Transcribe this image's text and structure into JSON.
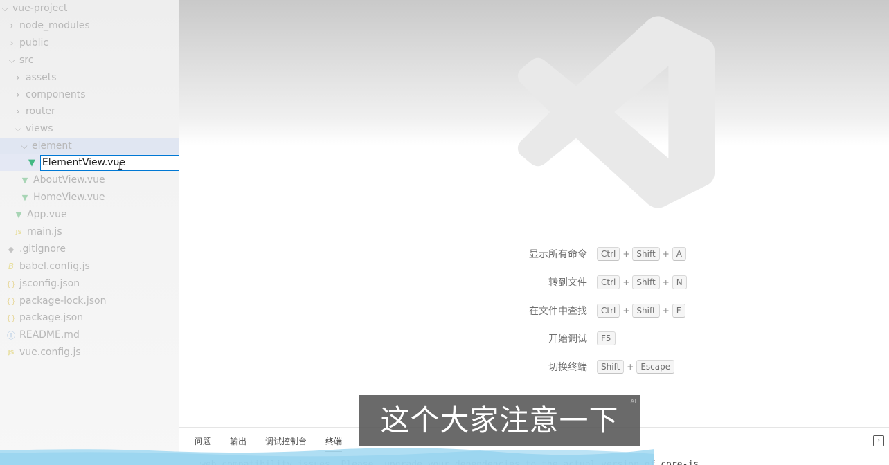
{
  "explorer": {
    "items": [
      {
        "label": "vue-project",
        "kind": "folder-open"
      },
      {
        "label": "node_modules",
        "kind": "folder"
      },
      {
        "label": "public",
        "kind": "folder"
      },
      {
        "label": "src",
        "kind": "folder-open"
      },
      {
        "label": "assets",
        "kind": "folder"
      },
      {
        "label": "components",
        "kind": "folder"
      },
      {
        "label": "router",
        "kind": "folder"
      },
      {
        "label": "views",
        "kind": "folder-open"
      },
      {
        "label": "element",
        "kind": "folder-open"
      },
      {
        "label": "ElementView.vue",
        "kind": "vue-rename"
      },
      {
        "label": "AboutView.vue",
        "kind": "vue"
      },
      {
        "label": "HomeView.vue",
        "kind": "vue"
      },
      {
        "label": "App.vue",
        "kind": "vue"
      },
      {
        "label": "main.js",
        "kind": "js"
      },
      {
        "label": ".gitignore",
        "kind": "git"
      },
      {
        "label": "babel.config.js",
        "kind": "babel"
      },
      {
        "label": "jsconfig.json",
        "kind": "json"
      },
      {
        "label": "package-lock.json",
        "kind": "json"
      },
      {
        "label": "package.json",
        "kind": "json"
      },
      {
        "label": "README.md",
        "kind": "info"
      },
      {
        "label": "vue.config.js",
        "kind": "js"
      }
    ],
    "rename_value": "ElementView.vue"
  },
  "icons": {
    "chevron_right": "chevron-right-icon",
    "chevron_down": "chevron-down-icon",
    "vue": "vue-file-icon",
    "js": "js-file-icon",
    "json": "json-file-icon",
    "git": "git-file-icon",
    "babel": "babel-file-icon",
    "info": "info-file-icon",
    "watermark": "vscode-logo-icon"
  },
  "shortcuts": [
    {
      "label": "显示所有命令",
      "keys": [
        "Ctrl",
        "Shift",
        "A"
      ]
    },
    {
      "label": "转到文件",
      "keys": [
        "Ctrl",
        "Shift",
        "N"
      ]
    },
    {
      "label": "在文件中查找",
      "keys": [
        "Ctrl",
        "Shift",
        "F"
      ]
    },
    {
      "label": "开始调试",
      "keys": [
        "F5"
      ]
    },
    {
      "label": "切换终端",
      "keys": [
        "Shift",
        "Escape"
      ]
    }
  ],
  "panel": {
    "tabs": [
      "问题",
      "输出",
      "调试控制台",
      "终端"
    ],
    "active_tab": "终端",
    "terminal_text": "web compatibility issues. Please, upgrade your dependencies to the actual version of core-js."
  },
  "subtitle": {
    "text": "这个大家注意一下",
    "badge": "AI"
  },
  "colors": {
    "accent": "#0078d4",
    "vue_green": "#41b883"
  }
}
